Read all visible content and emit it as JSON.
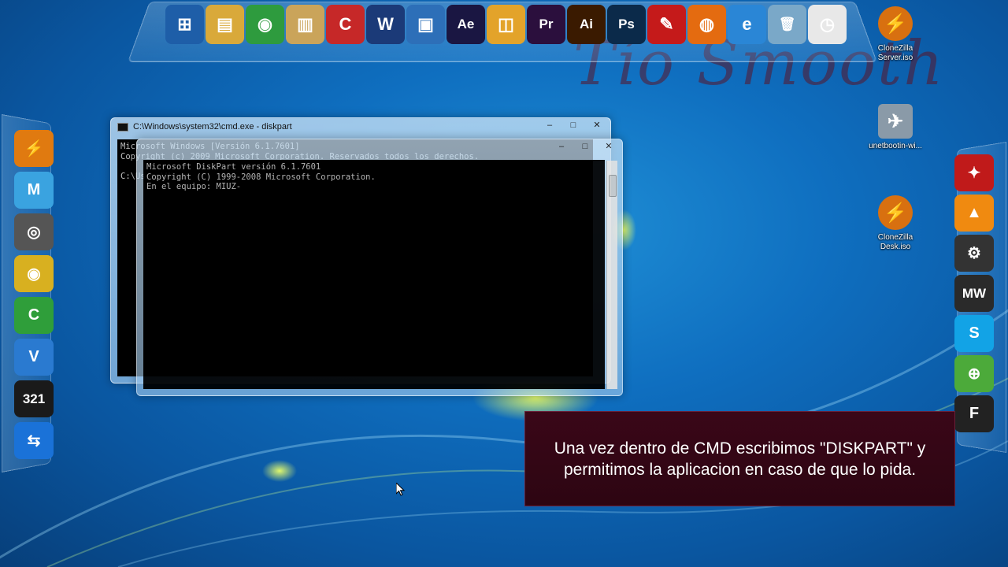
{
  "watermark": "Tío Smooth",
  "top_dock": {
    "icons": [
      {
        "name": "windows-start-icon",
        "glyph": "⊞",
        "color": "#1e5ea8"
      },
      {
        "name": "folder-icon",
        "glyph": "▤",
        "color": "#d9a93a"
      },
      {
        "name": "chrome-icon",
        "glyph": "◉",
        "color": "#2e9b3e"
      },
      {
        "name": "library-icon",
        "glyph": "▥",
        "color": "#caa45a"
      },
      {
        "name": "ccleaner-icon",
        "glyph": "C",
        "color": "#c62828"
      },
      {
        "name": "wordpad-icon",
        "glyph": "W",
        "color": "#1b3a78"
      },
      {
        "name": "network-icon",
        "glyph": "▣",
        "color": "#2d6fb8"
      },
      {
        "name": "after-effects-icon",
        "glyph": "Ae",
        "color": "#1a1642"
      },
      {
        "name": "window-icon",
        "glyph": "◫",
        "color": "#e3a32a"
      },
      {
        "name": "premiere-icon",
        "glyph": "Pr",
        "color": "#2b0f3d"
      },
      {
        "name": "illustrator-icon",
        "glyph": "Ai",
        "color": "#3a1a00"
      },
      {
        "name": "photoshop-icon",
        "glyph": "Ps",
        "color": "#0b2a4a"
      },
      {
        "name": "acrobat-icon",
        "glyph": "✎",
        "color": "#c51a1a"
      },
      {
        "name": "firefox-icon",
        "glyph": "◍",
        "color": "#e46b10"
      },
      {
        "name": "internet-explorer-icon",
        "glyph": "e",
        "color": "#2a86d6"
      },
      {
        "name": "recycle-bin-icon",
        "glyph": "🗑",
        "color": "#7aa8c8"
      },
      {
        "name": "clock-icon",
        "glyph": "◷",
        "color": "#e8e8e8"
      }
    ]
  },
  "left_dock": {
    "icons": [
      {
        "name": "daemon-tools-icon",
        "glyph": "⚡",
        "color": "#e07a10"
      },
      {
        "name": "cloud-m-icon",
        "glyph": "M",
        "color": "#3aa3e0"
      },
      {
        "name": "media-icon",
        "glyph": "◎",
        "color": "#555"
      },
      {
        "name": "dvd-icon",
        "glyph": "◉",
        "color": "#d8b020"
      },
      {
        "name": "camtasia-icon",
        "glyph": "C",
        "color": "#2f9e3a"
      },
      {
        "name": "vectorial-icon",
        "glyph": "V",
        "color": "#2a7ad0"
      },
      {
        "name": "media-player-classic-icon",
        "glyph": "321",
        "color": "#1a1a1a"
      },
      {
        "name": "teamviewer-icon",
        "glyph": "⇆",
        "color": "#1a72d8"
      }
    ]
  },
  "right_dock": {
    "icons": [
      {
        "name": "remote-icon",
        "glyph": "✦",
        "color": "#c01a1a"
      },
      {
        "name": "vlc-icon",
        "glyph": "▲",
        "color": "#f08a10"
      },
      {
        "name": "update-icon",
        "glyph": "⚙",
        "color": "#333"
      },
      {
        "name": "nfs-mw-icon",
        "glyph": "MW",
        "color": "#2a2a2a"
      },
      {
        "name": "skype-icon",
        "glyph": "S",
        "color": "#12a3e6"
      },
      {
        "name": "lock-cloud-icon",
        "glyph": "⊕",
        "color": "#4caa3a"
      },
      {
        "name": "filezilla-icon",
        "glyph": "F",
        "color": "#222"
      }
    ]
  },
  "desktop_icons": [
    {
      "name": "clonezilla-server-icon",
      "label": "CloneZilla\nServer.iso",
      "glyph": "⚡",
      "color": "#d87010"
    },
    {
      "name": "unetbootin-icon",
      "label": "unetbootin-wi...",
      "glyph": "✈",
      "color": "#8a9aa8"
    },
    {
      "name": "clonezilla-desk-icon",
      "label": "CloneZilla\nDesk.iso",
      "glyph": "⚡",
      "color": "#d87010"
    }
  ],
  "cmd_back": {
    "title": "C:\\Windows\\system32\\cmd.exe - diskpart",
    "lines": "Microsoft Windows [Versión 6.1.7601]\nCopyright (c) 2009 Microsoft Corporation. Reservados todos los derechos.\n\nC:\\Users\\Miuz>"
  },
  "cmd_front": {
    "lines": "Microsoft DiskPart versión 6.1.7601\nCopyright (C) 1999-2008 Microsoft Corporation.\nEn el equipo: MIUZ-"
  },
  "window_controls": {
    "minimize": "–",
    "maximize": "□",
    "close": "✕"
  },
  "caption": "Una vez dentro de CMD escribimos \"DISKPART\" y permitimos la aplicacion en caso de que lo pida."
}
